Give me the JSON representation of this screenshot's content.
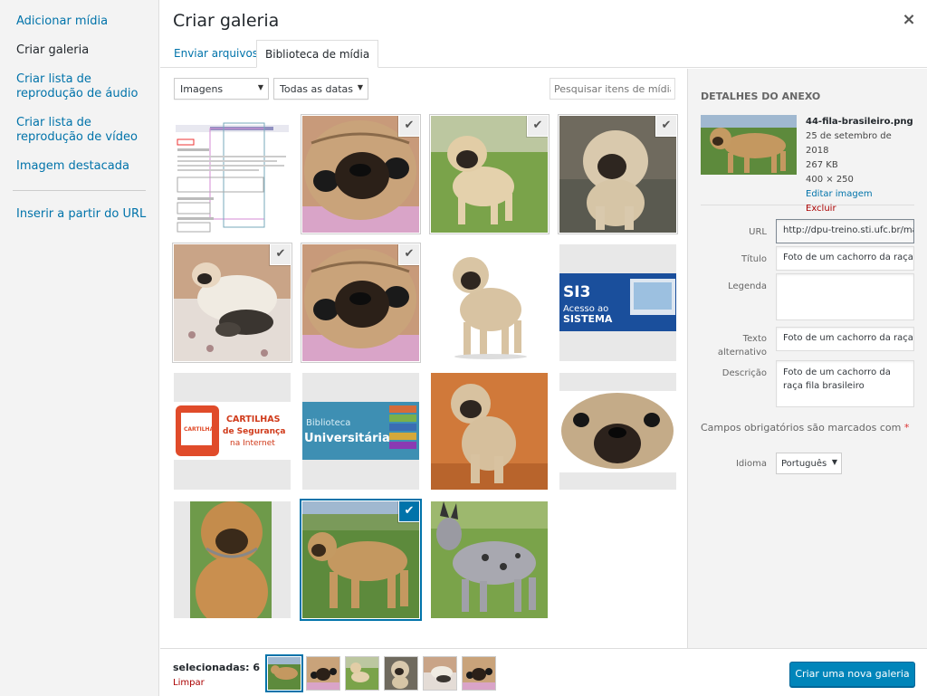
{
  "menu": {
    "items": [
      {
        "label": "Adicionar mídia"
      },
      {
        "label": "Criar galeria"
      },
      {
        "label": "Criar lista de reprodução de áudio"
      },
      {
        "label": "Criar lista de reprodução de vídeo"
      },
      {
        "label": "Imagem destacada"
      },
      {
        "label": "Inserir a partir do URL"
      }
    ]
  },
  "header": {
    "title": "Criar galeria",
    "close_icon": "×"
  },
  "tabs": [
    {
      "label": "Enviar arquivos"
    },
    {
      "label": "Biblioteca de mídia"
    }
  ],
  "toolbar": {
    "type_filter": "Imagens",
    "date_filter": "Todas as datas",
    "search_placeholder": "Pesquisar itens de mídia..."
  },
  "grid": {
    "items": [
      {
        "kind": "screenshot",
        "selected": false
      },
      {
        "kind": "pug-face",
        "selected": true
      },
      {
        "kind": "pug-grass",
        "selected": true
      },
      {
        "kind": "pug-puppy",
        "selected": true
      },
      {
        "kind": "pug-litter",
        "selected": true
      },
      {
        "kind": "pug-face",
        "selected": true
      },
      {
        "kind": "pug-white",
        "selected": false
      },
      {
        "kind": "si3-banner",
        "selected": false,
        "text1": "SI3",
        "text2": "Acesso ao",
        "text3": "SISTEMA"
      },
      {
        "kind": "cartilhas-banner",
        "selected": false,
        "text1": "CARTILHAS",
        "text2": "de Segurança",
        "text3": "na Internet",
        "text4": "CARTILHA"
      },
      {
        "kind": "biblioteca-banner",
        "selected": false,
        "text1": "Biblioteca",
        "text2": "Universitária"
      },
      {
        "kind": "pug-orange",
        "selected": false
      },
      {
        "kind": "pug-closeup",
        "selected": false
      },
      {
        "kind": "mastiff-front",
        "selected": false
      },
      {
        "kind": "fila-dog",
        "selected": true,
        "focused": true
      },
      {
        "kind": "heeler",
        "selected": false
      }
    ],
    "check_icon": "✔"
  },
  "sidebar": {
    "heading": "DETALHES DO ANEXO",
    "filename": "44-fila-brasileiro.png",
    "date": "25 de setembro de 2018",
    "size": "267 KB",
    "dimensions": "400 × 250",
    "edit_link": "Editar imagem",
    "delete_link": "Excluir permanentemente",
    "fields": {
      "url_label": "URL",
      "url_value": "http://dpu-treino.sti.ufc.br/ma",
      "title_label": "Título",
      "title_value": "Foto de um cachorro da raça",
      "caption_label": "Legenda",
      "caption_value": "",
      "alt_label_1": "Texto",
      "alt_label_2": "alternativo",
      "alt_value": "Foto de um cachorro da raça",
      "desc_label": "Descrição",
      "desc_value": "Foto de um cachorro da raça fila brasileiro"
    },
    "required_note": "Campos obrigatórios são marcados com",
    "required_star": "*",
    "language_label": "Idioma",
    "language_value": "Português"
  },
  "bottom": {
    "selected_count": "selecionadas: 6",
    "clear_label": "Limpar",
    "primary_button": "Criar uma nova galeria"
  },
  "colors": {
    "accent": "#0073aa",
    "primary_button": "#0085ba",
    "danger": "#a00"
  }
}
